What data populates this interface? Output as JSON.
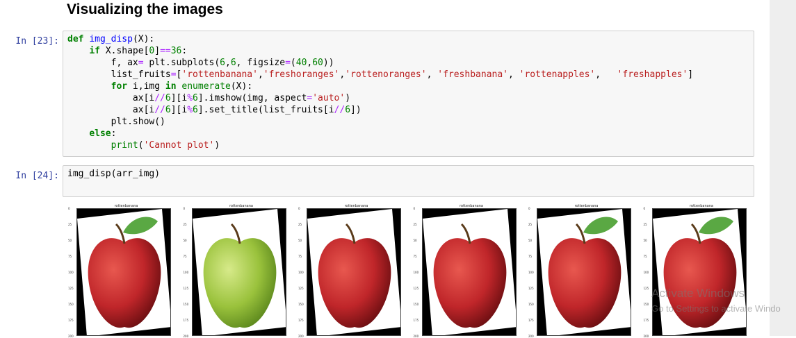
{
  "notebook": {
    "heading": "Visualizing the images",
    "cells": [
      {
        "prompt": "In [23]:",
        "code_lines": [
          "def img_disp(X):",
          "    if X.shape[0]==36:",
          "        f, ax= plt.subplots(6,6, figsize=(40,60))",
          "        list_fruits=['rottenbanana','freshoranges','rottenoranges', 'freshbanana', 'rottenapples',   'freshapples']",
          "        for i,img in enumerate(X):",
          "            ax[i//6][i%6].imshow(img, aspect='auto')",
          "            ax[i//6][i%6].set_title(list_fruits[i//6])",
          "        plt.show()",
          "    else:",
          "        print('Cannot plot')"
        ]
      },
      {
        "prompt": "In [24]:",
        "code_lines": [
          "img_disp(arr_img)"
        ]
      }
    ]
  },
  "output": {
    "panels": [
      {
        "title": "rottenbanana",
        "apple": "red",
        "leaf": true,
        "ytick_labels": [
          "0",
          "25",
          "50",
          "75",
          "100",
          "125",
          "150",
          "175",
          "200"
        ]
      },
      {
        "title": "rottenbanana",
        "apple": "green",
        "leaf": false,
        "ytick_labels": [
          "0",
          "25",
          "50",
          "75",
          "100",
          "125",
          "150",
          "175",
          "200"
        ]
      },
      {
        "title": "rottenbanana",
        "apple": "red",
        "leaf": false,
        "ytick_labels": [
          "0",
          "25",
          "50",
          "75",
          "100",
          "125",
          "150",
          "175",
          "200"
        ]
      },
      {
        "title": "rottenbanana",
        "apple": "red",
        "leaf": false,
        "ytick_labels": [
          "0",
          "25",
          "50",
          "75",
          "100",
          "125",
          "150",
          "175",
          "200"
        ]
      },
      {
        "title": "rottenbanana",
        "apple": "red",
        "leaf": true,
        "ytick_labels": [
          "0",
          "25",
          "50",
          "75",
          "100",
          "125",
          "150",
          "175",
          "200"
        ]
      },
      {
        "title": "rottenbanana",
        "apple": "red",
        "leaf": true,
        "ytick_labels": [
          "0",
          "25",
          "50",
          "75",
          "100",
          "125",
          "150",
          "175",
          "200"
        ]
      }
    ]
  },
  "watermark": {
    "line1": "Activate Windows",
    "line2": "Go to Settings to activate Windo"
  },
  "colors": {
    "prompt": "#303f9f",
    "cell_bg": "#f7f7f7",
    "keyword": "#008000",
    "string": "#ba2121",
    "apple_red": "#c0262a",
    "apple_green": "#9ac23c"
  }
}
